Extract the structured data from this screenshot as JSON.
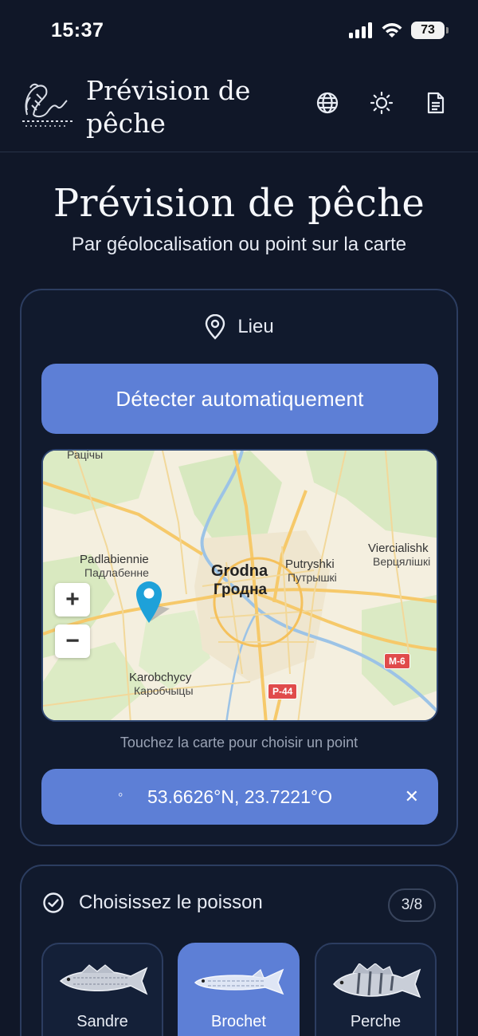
{
  "status": {
    "time": "15:37",
    "battery": "73"
  },
  "header": {
    "title": "Prévision de pêche",
    "icons": [
      "globe-icon",
      "sun-icon",
      "document-icon"
    ]
  },
  "hero": {
    "title": "Prévision de pêche",
    "subtitle": "Par géolocalisation ou point sur la carte"
  },
  "location": {
    "label": "Lieu",
    "detect_button": "Détecter automatiquement",
    "map": {
      "labels": {
        "racicy": "Рацічы",
        "padlabienne": "Padlabiennie",
        "padlabienne_cyr": "Падлабенне",
        "grodna": "Grodna",
        "grodna_cyr": "Гродна",
        "putryshki": "Putryshki",
        "putryshki_cyr": "Путрышкі",
        "viercialishki": "Viercialishk",
        "viercialishki_cyr": "Верцялішкі",
        "karobchycy": "Karobchycy",
        "karobchycy_cyr": "Каробчыцы"
      },
      "roads": {
        "m6": "M-6",
        "p44": "P-44"
      },
      "zoom_in": "+",
      "zoom_out": "−"
    },
    "map_hint": "Touchez la carte pour choisir un point",
    "coords": "53.6626°N, 23.7221°O",
    "coords_bullet": "◦",
    "clear": "✕"
  },
  "fish": {
    "title": "Choisissez le poisson",
    "count": "3/8",
    "items": [
      {
        "name": "Sandre",
        "selected": false
      },
      {
        "name": "Brochet",
        "selected": true
      },
      {
        "name": "Perche",
        "selected": false
      }
    ]
  },
  "colors": {
    "background": "#101728",
    "accent": "#5d7fd6",
    "card_border": "#2c3d60"
  }
}
